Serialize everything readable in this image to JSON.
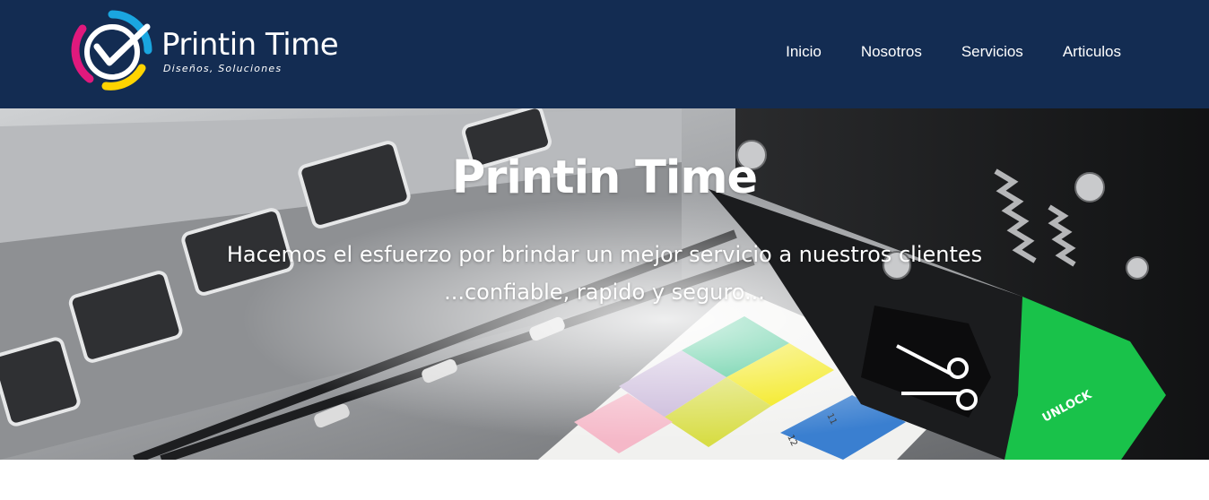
{
  "header": {
    "logo": {
      "title": "Printin Time",
      "tagline": "Diseños, Soluciones"
    },
    "nav": [
      {
        "label": "Inicio"
      },
      {
        "label": "Nosotros"
      },
      {
        "label": "Servicios"
      },
      {
        "label": "Articulos"
      }
    ]
  },
  "hero": {
    "title": "Printin Time",
    "subtitle": "Hacemos el esfuerzo por brindar un mejor servicio a nuestros clientes ...confiable, rapido y seguro...",
    "image": "printer-closeup-with-color-calibration-strip",
    "image_labels": {
      "unlock": "UNLOCK",
      "ticks": [
        "10",
        "11",
        "12"
      ]
    }
  },
  "colors": {
    "header_bg": "#132c52",
    "text": "#ffffff",
    "logo_cyan": "#1aa6e0",
    "logo_magenta": "#e0197d",
    "logo_yellow": "#ffd400",
    "unlock_green": "#19c24a"
  }
}
